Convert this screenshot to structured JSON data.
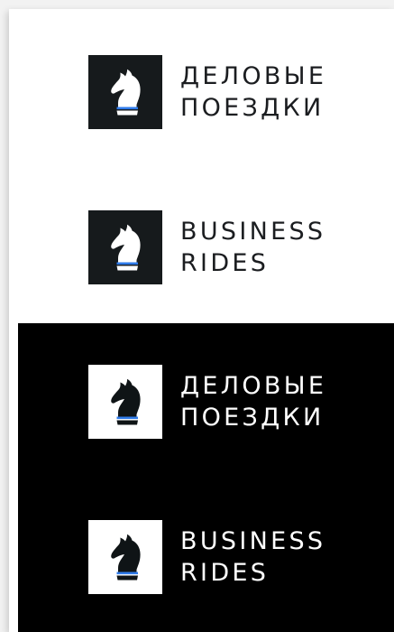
{
  "colors": {
    "page_background": "#ffffff",
    "dark_background": "#000000",
    "emblem_dark": "#161a1c",
    "knight_dark": "#0f1416",
    "knight_light": "#ffffff",
    "accent_blue": "#2f7bea",
    "text_dark": "#1b1d20",
    "text_light": "#ffffff"
  },
  "logos": [
    {
      "variant": "dark-emblem-on-light",
      "icon": "knight-chess-piece-icon",
      "line1": "ДЕЛОВЫЕ",
      "line2": "ПОЕЗДКИ"
    },
    {
      "variant": "dark-emblem-on-light",
      "icon": "knight-chess-piece-icon",
      "line1": "BUSINESS",
      "line2": "RIDES"
    },
    {
      "variant": "light-emblem-on-dark",
      "icon": "knight-chess-piece-icon",
      "line1": "ДЕЛОВЫЕ",
      "line2": "ПОЕЗДКИ"
    },
    {
      "variant": "light-emblem-on-dark",
      "icon": "knight-chess-piece-icon",
      "line1": "BUSINESS",
      "line2": "RIDES"
    }
  ]
}
